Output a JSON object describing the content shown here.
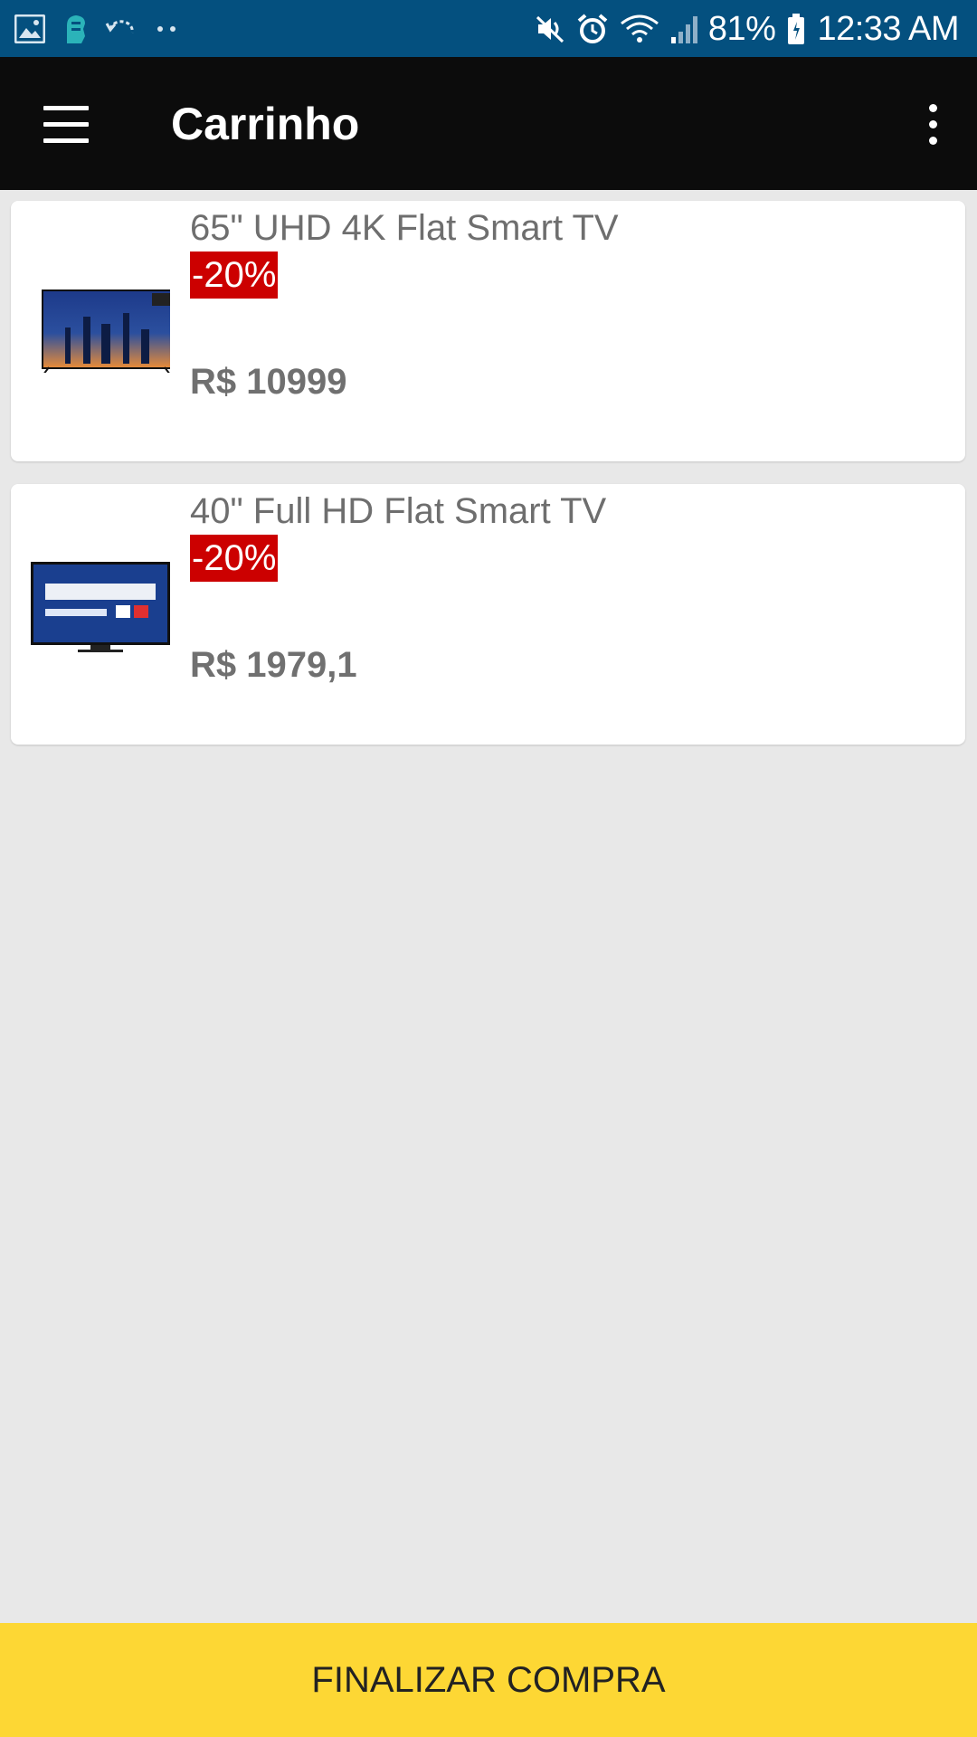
{
  "status_bar": {
    "battery": "81%",
    "time": "12:33 AM",
    "icons": [
      "gallery-icon",
      "notification-app-icon",
      "sync-icon",
      "more-notifications-icon",
      "mute-icon",
      "alarm-icon",
      "wifi-icon",
      "signal-icon",
      "battery-icon"
    ]
  },
  "app_bar": {
    "title": "Carrinho",
    "menu_icon": "hamburger-menu-icon",
    "overflow_icon": "more-vert-icon"
  },
  "cart": {
    "items": [
      {
        "name": "65\" UHD 4K Flat Smart TV",
        "discount": "-20%",
        "price": "R$ 10999"
      },
      {
        "name": "40\" Full HD Flat Smart TV",
        "discount": "-20%",
        "price": "R$ 1979,1"
      }
    ]
  },
  "footer": {
    "checkout_label": "FINALIZAR COMPRA"
  },
  "colors": {
    "status_bar": "#04507f",
    "app_bar": "#0c0c0c",
    "background": "#e8e8e8",
    "discount": "#cc0000",
    "checkout": "#fdd734"
  }
}
